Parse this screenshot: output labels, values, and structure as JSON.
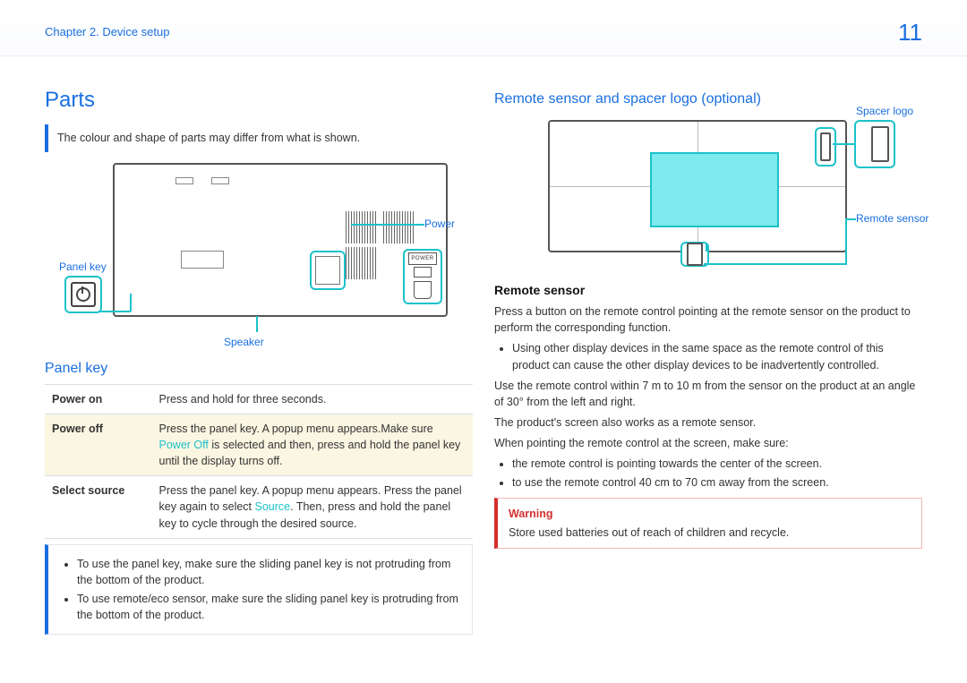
{
  "header": {
    "chapter": "Chapter 2. Device setup",
    "page_number": "11"
  },
  "left": {
    "title": "Parts",
    "note": "The colour and shape of parts may differ from what is shown.",
    "diagram_labels": {
      "panel_key": "Panel key",
      "speaker": "Speaker",
      "power": "Power",
      "power_button_text": "POWER"
    },
    "panel_key_heading": "Panel key",
    "table": [
      {
        "name": "Power on",
        "desc_parts": [
          {
            "t": "Press and hold for three seconds."
          }
        ],
        "hl": false
      },
      {
        "name": "Power off",
        "desc_parts": [
          {
            "t": "Press the panel key. A popup menu appears."
          },
          {
            "t": "Make sure "
          },
          {
            "t": "Power Off",
            "kw": true
          },
          {
            "t": " is selected and then, press and hold the panel key until the display turns off."
          }
        ],
        "hl": true
      },
      {
        "name": "Select source",
        "desc_parts": [
          {
            "t": "Press the panel key. A popup menu appears."
          },
          {
            "t": " Press the panel key again to select "
          },
          {
            "t": "Source",
            "kw": true
          },
          {
            "t": ". Then, press and hold the panel key to cycle through the desired source."
          }
        ],
        "hl": false
      }
    ],
    "info": [
      "To use the panel key, make sure the sliding panel key is not protruding from the bottom of the product.",
      "To use remote/eco sensor, make sure the sliding panel key is protruding from the bottom of the product."
    ]
  },
  "right": {
    "heading": "Remote sensor and spacer logo (optional)",
    "diagram_labels": {
      "spacer_logo": "Spacer logo",
      "remote_sensor": "Remote sensor"
    },
    "rs_heading": "Remote sensor",
    "p1": "Press a button on the remote control pointing at the remote sensor on the product to perform the corresponding function.",
    "bul1": "Using other display devices in the same space as the remote control of this product can cause the other display devices to be inadvertently controlled.",
    "p2": "Use the remote control within 7 m to 10 m from the sensor on the product at an angle of 30° from the left and right.",
    "p3": "The product's screen also works as a remote sensor.",
    "p4": "When pointing the remote control at the screen, make sure:",
    "bul2": [
      "the remote control is pointing towards the center of the screen.",
      "to use the remote control 40 cm to 70 cm away from the screen."
    ],
    "warning": {
      "title": "Warning",
      "text": "Store used batteries out of reach of children and recycle."
    }
  }
}
